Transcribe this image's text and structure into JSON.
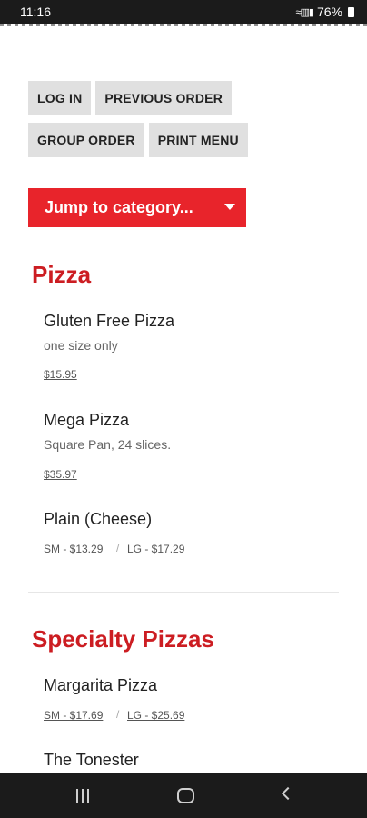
{
  "status": {
    "time": "11:16",
    "battery": "76%"
  },
  "buttons": {
    "login": "LOG IN",
    "previous_order": "PREVIOUS ORDER",
    "group_order": "GROUP ORDER",
    "print_menu": "PRINT MENU"
  },
  "jump": {
    "label": "Jump to category..."
  },
  "sections": {
    "pizza": {
      "title": "Pizza",
      "items": [
        {
          "name": "Gluten Free Pizza",
          "description": "one size only",
          "price": "$15.95"
        },
        {
          "name": "Mega Pizza",
          "description": "Square Pan, 24 slices.",
          "price": "$35.97"
        },
        {
          "name": "Plain (Cheese)",
          "sm": "SM - $13.29",
          "lg": "LG - $17.29"
        }
      ]
    },
    "specialty": {
      "title": "Specialty Pizzas",
      "items": [
        {
          "name": "Margarita Pizza",
          "sm": "SM - $17.69",
          "lg": "LG - $25.69"
        },
        {
          "name": "The Tonester"
        }
      ]
    }
  },
  "separator": "/",
  "colors": {
    "accent": "#e8242b",
    "heading": "#cc1d22"
  },
  "icons": {
    "recents": "recents-icon",
    "home": "home-icon",
    "back": "back-icon"
  }
}
